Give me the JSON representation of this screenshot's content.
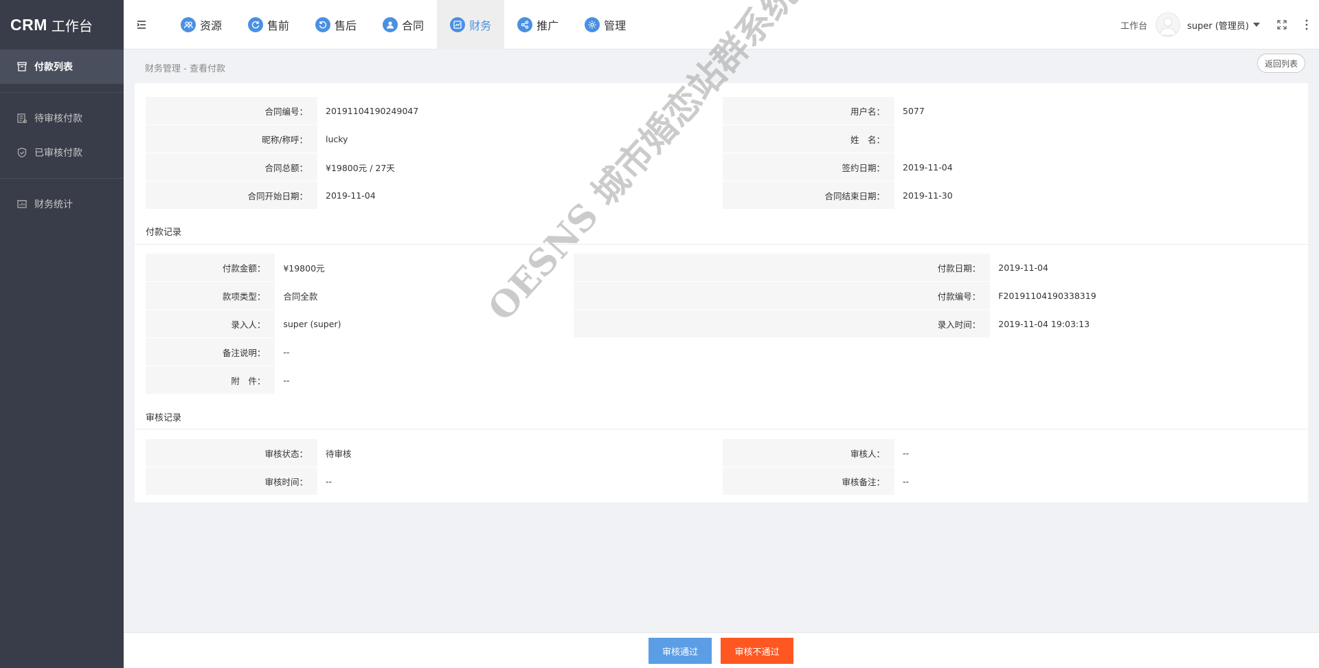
{
  "brand": {
    "crm": "CRM",
    "title": "工作台"
  },
  "sidebar": {
    "items": [
      {
        "label": "付款列表",
        "icon": "archive-icon",
        "active": true
      },
      {
        "label": "待审核付款",
        "icon": "document-list-icon"
      },
      {
        "label": "已审核付款",
        "icon": "shield-check-icon"
      },
      {
        "label": "财务统计",
        "icon": "stats-icon"
      }
    ]
  },
  "topnav": {
    "items": [
      {
        "label": "资源"
      },
      {
        "label": "售前"
      },
      {
        "label": "售后"
      },
      {
        "label": "合同"
      },
      {
        "label": "财务",
        "active": true
      },
      {
        "label": "推广"
      },
      {
        "label": "管理"
      }
    ],
    "workbench": "工作台",
    "user": "super (管理员)"
  },
  "breadcrumb": "财务管理 - 查看付款",
  "back_button": "返回列表",
  "contract": {
    "contract_no_label": "合同编号：",
    "contract_no": "20191104190249047",
    "username_label": "用户名：",
    "username": "5077",
    "nickname_label": "昵称/称呼：",
    "nickname": "lucky",
    "name_label": "姓　名：",
    "name": "",
    "total_label": "合同总额：",
    "total": "¥19800元 / 27天",
    "sign_date_label": "签约日期：",
    "sign_date": "2019-11-04",
    "start_label": "合同开始日期：",
    "start": "2019-11-04",
    "end_label": "合同结束日期：",
    "end": "2019-11-30"
  },
  "payment": {
    "section_title": "付款记录",
    "amount_label": "付款金额：",
    "amount": "¥19800元",
    "date_label": "付款日期：",
    "date": "2019-11-04",
    "type_label": "款项类型：",
    "type": "合同全款",
    "no_label": "付款编号：",
    "no": "F20191104190338319",
    "entry_label": "录入人：",
    "entry": "super (super)",
    "entry_time_label": "录入时间：",
    "entry_time": "2019-11-04 19:03:13",
    "remark_label": "备注说明：",
    "remark": "--",
    "attachment_label": "附　件：",
    "attachment": "--"
  },
  "audit": {
    "section_title": "审核记录",
    "status_label": "审核状态：",
    "status": "待审核",
    "auditor_label": "审核人：",
    "auditor": "--",
    "time_label": "审核时间：",
    "time": "--",
    "remark_label": "审核备注：",
    "remark": "--"
  },
  "actions": {
    "approve": "审核通过",
    "reject": "审核不通过"
  },
  "watermark": "OESNS 城市婚恋站群系统",
  "colors": {
    "sidebar": "#393d49",
    "accent": "#4a90e2",
    "approve": "#5c9ee6",
    "reject": "#ff5722"
  }
}
